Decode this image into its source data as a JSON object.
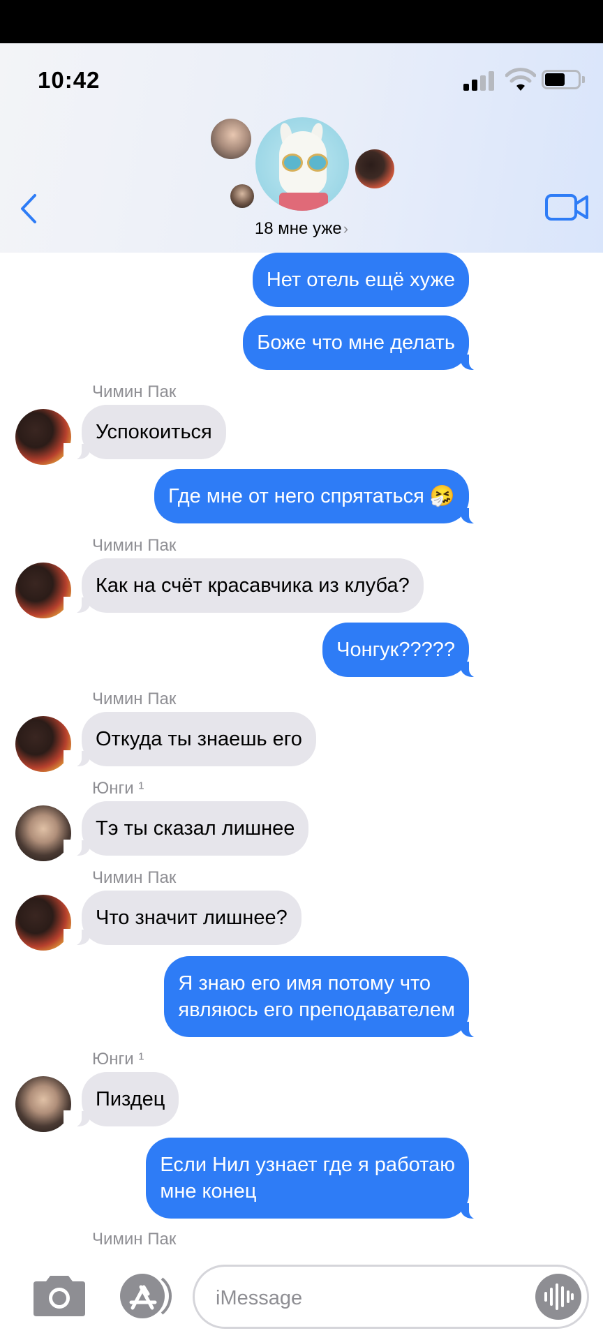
{
  "status_bar": {
    "time": "10:42"
  },
  "header": {
    "group_name": "18 мне уже",
    "chevron": "›"
  },
  "messages": [
    {
      "dir": "out",
      "text": "Нет отель ещё хуже"
    },
    {
      "dir": "out",
      "text": "Боже что мне делать"
    },
    {
      "dir": "in",
      "sender": "Чимин Пак",
      "text": "Успокоиться"
    },
    {
      "dir": "out",
      "text": "Где мне от него спрятаться 🤧"
    },
    {
      "dir": "in",
      "sender": "Чимин Пак",
      "text": "Как на счёт красавчика из клуба?"
    },
    {
      "dir": "out",
      "text": "Чонгук?????"
    },
    {
      "dir": "in",
      "sender": "Чимин Пак",
      "text": "Откуда ты знаешь его"
    },
    {
      "dir": "in",
      "sender": "Юнги ¹",
      "text": "Тэ ты  сказал лишнее"
    },
    {
      "dir": "in",
      "sender": "Чимин Пак",
      "text": "Что значит лишнее?"
    },
    {
      "dir": "out",
      "line1": "Я знаю его имя потому что",
      "line2": "являюсь его преподавателем"
    },
    {
      "dir": "in",
      "sender": "Юнги ¹",
      "text": "Пиздец"
    },
    {
      "dir": "out",
      "line1": "Если Нил узнает где я работаю",
      "line2": "мне конец"
    },
    {
      "dir": "in",
      "sender": "Чимин Пак"
    }
  ],
  "composer": {
    "placeholder": "iMessage"
  },
  "icons": [
    "back-chevron-icon",
    "video-camera-icon",
    "camera-icon",
    "app-store-icon",
    "audio-waveform-icon"
  ],
  "colors": {
    "outgoing": "#2e7cf6",
    "incoming": "#e6e5eb",
    "accent": "#2e7cf6",
    "sender": "#8e8e93"
  }
}
